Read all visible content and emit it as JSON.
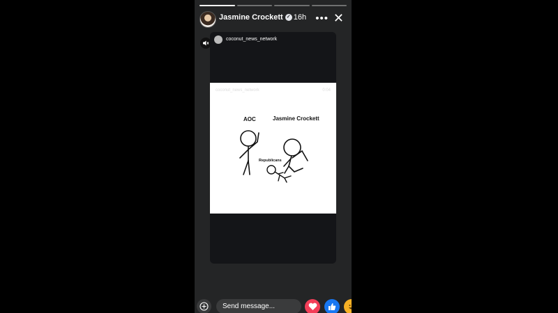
{
  "story": {
    "user": "Jasmine Crockett",
    "time": "16h",
    "progress_segments": 4,
    "progress_completed": 1
  },
  "shared_post": {
    "username": "coconut_news_network",
    "watermark": "coconut_news_network",
    "timestamp": "0:04",
    "labels": {
      "left": "AOC",
      "right": "Jasmine Crockett",
      "ground": "Republicans"
    }
  },
  "composer": {
    "placeholder": "Send message..."
  },
  "reactions": [
    "love",
    "like",
    "haha"
  ],
  "icons": {
    "more": "more-horizontal-icon",
    "close": "close-icon",
    "mute": "speaker-muted-icon",
    "add": "add-circle-icon"
  },
  "colors": {
    "love": "#f33e58",
    "like": "#1877f2",
    "haha": "#f7b125"
  }
}
